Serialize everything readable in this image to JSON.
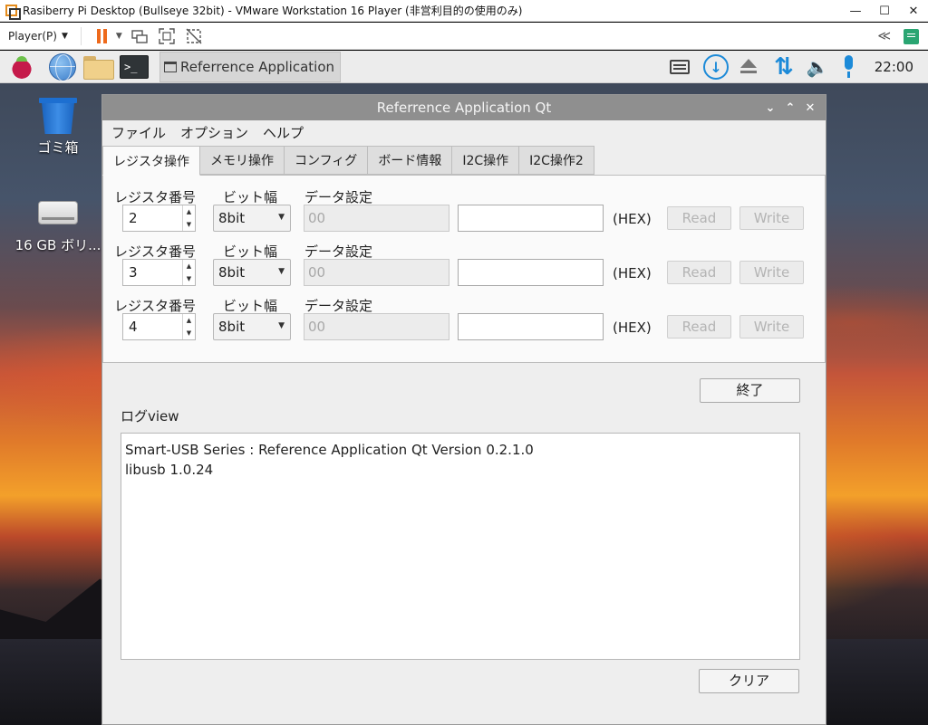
{
  "vm": {
    "title": "Rasiberry Pi Desktop (Bullseye 32bit) - VMware Workstation 16 Player (非営利目的の使用のみ)",
    "player_menu": "Player(P)",
    "window_controls": {
      "minimize": "—",
      "maximize": "☐",
      "close": "✕"
    },
    "collapse_glyph": "≪"
  },
  "panel": {
    "task_label": "Referrence Application ...",
    "clock": "22:00",
    "terminal_glyph": ">_"
  },
  "desktop_icons": {
    "trash": "ゴミ箱",
    "drive": "16 GB ボリ..."
  },
  "app": {
    "title": "Referrence Application Qt",
    "title_controls": {
      "minimize": "⌄",
      "maximize": "⌃",
      "close": "✕"
    },
    "menu": [
      "ファイル",
      "オプション",
      "ヘルプ"
    ],
    "tabs": [
      "レジスタ操作",
      "メモリ操作",
      "コンフィグ",
      "ボード情報",
      "I2C操作",
      "I2C操作2"
    ],
    "active_tab": 0,
    "register_rows": [
      {
        "reg_label": "レジスタ番号",
        "width_label": "ビット幅",
        "data_label": "データ設定",
        "reg_value": "2",
        "bit_width": "8bit",
        "data_readonly": "00",
        "data_input": "",
        "hex": "(HEX)",
        "read": "Read",
        "write": "Write"
      },
      {
        "reg_label": "レジスタ番号",
        "width_label": "ビット幅",
        "data_label": "データ設定",
        "reg_value": "3",
        "bit_width": "8bit",
        "data_readonly": "00",
        "data_input": "",
        "hex": "(HEX)",
        "read": "Read",
        "write": "Write"
      },
      {
        "reg_label": "レジスタ番号",
        "width_label": "ビット幅",
        "data_label": "データ設定",
        "reg_value": "4",
        "bit_width": "8bit",
        "data_readonly": "00",
        "data_input": "",
        "hex": "(HEX)",
        "read": "Read",
        "write": "Write"
      }
    ],
    "exit_button": "終了",
    "log_label": "ログview",
    "log_lines": [
      "Smart-USB Series : Reference Application Qt Version 0.2.1.0",
      "libusb 1.0.24"
    ],
    "clear_button": "クリア"
  }
}
